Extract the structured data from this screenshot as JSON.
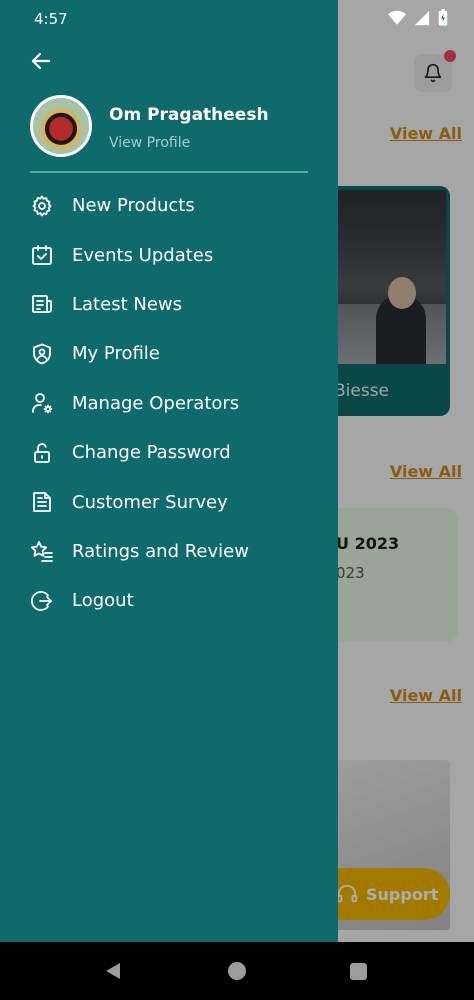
{
  "status_bar": {
    "time": "4:57"
  },
  "drawer": {
    "profile": {
      "name": "Om Pragatheesh",
      "subtitle": "View Profile"
    },
    "menu": [
      {
        "label": "New Products",
        "icon": "gear-icon"
      },
      {
        "label": "Events Updates",
        "icon": "calendar-check-icon"
      },
      {
        "label": "Latest News",
        "icon": "news-icon"
      },
      {
        "label": "My Profile",
        "icon": "shield-user-icon"
      },
      {
        "label": "Manage Operators",
        "icon": "user-gear-icon"
      },
      {
        "label": "Change Password",
        "icon": "lock-icon"
      },
      {
        "label": "Customer Survey",
        "icon": "document-icon"
      },
      {
        "label": "Ratings and Review",
        "icon": "star-list-icon"
      },
      {
        "label": "Logout",
        "icon": "logout-icon"
      }
    ]
  },
  "background": {
    "view_all_1": "View All",
    "view_all_2": "View All",
    "view_all_3": "View All",
    "product_label": "Biesse",
    "event_title": "U 2023",
    "event_sub": "023",
    "support_label": "Support"
  },
  "colors": {
    "drawer": "#0f6b6b",
    "accent": "#c98a1a",
    "support": "#f0b400"
  }
}
